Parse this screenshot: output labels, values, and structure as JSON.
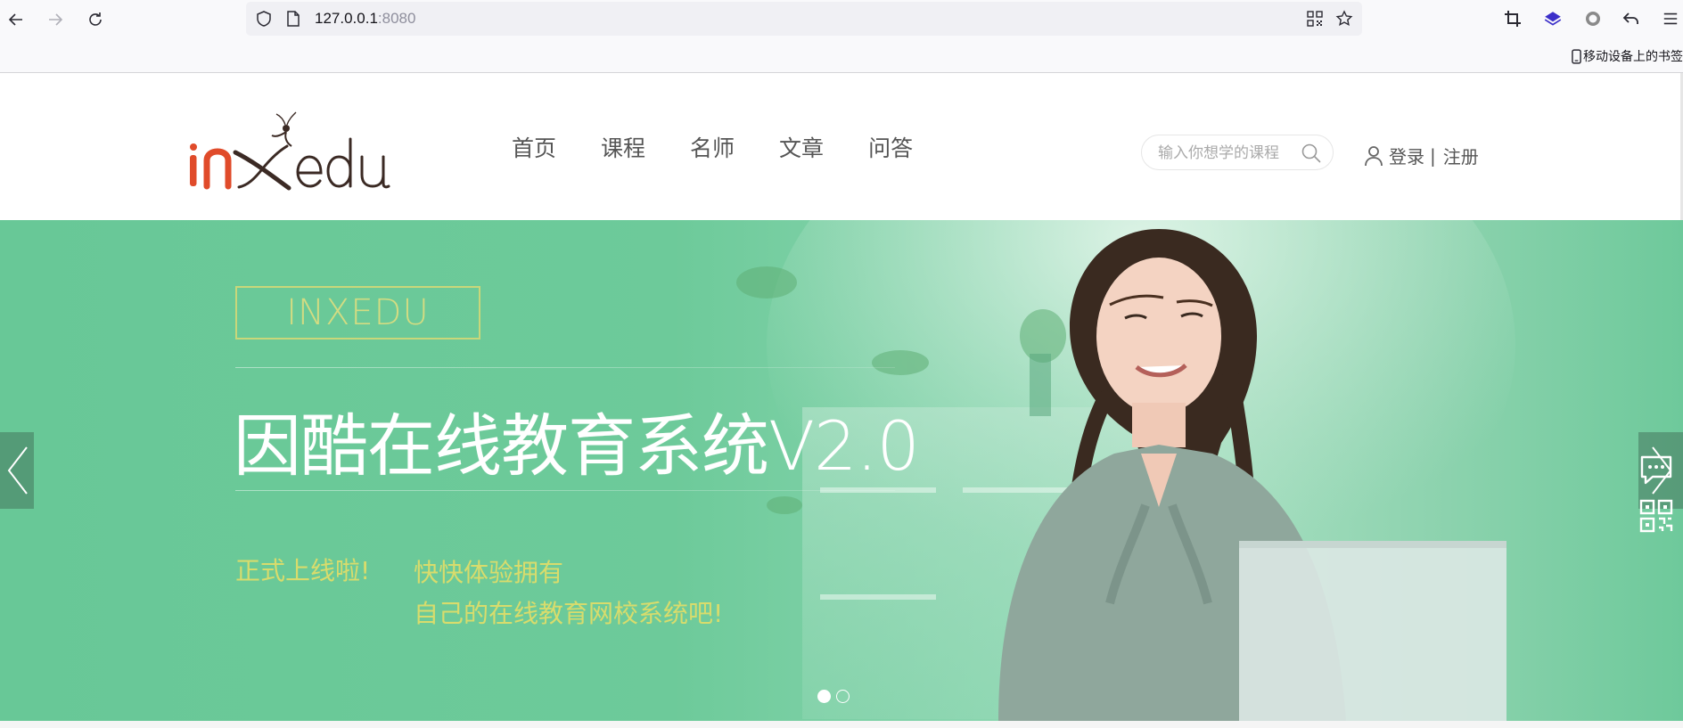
{
  "browser": {
    "url_host": "127.0.0.1",
    "url_port": ":8080",
    "mobile_bookmarks_label": "移动设备上的书签"
  },
  "site": {
    "nav": [
      "首页",
      "课程",
      "名师",
      "文章",
      "问答"
    ],
    "search_placeholder": "输入你想学的课程",
    "login_label": "登录",
    "separator": "|",
    "register_label": "注册"
  },
  "banner": {
    "brand_box": "INXEDU",
    "headline": "因酷在线教育系统V2.0",
    "tag_online": "正式上线啦!",
    "tag_try_line1": "快快体验拥有",
    "tag_try_line2": "自己的在线教育网校系统吧!",
    "slides_total": 2,
    "active_slide": 1
  },
  "colors": {
    "banner_green": "#68c897",
    "accent_yellow": "#d8dc6c",
    "logo_orange": "#e04b2a",
    "logo_brown": "#3b2a24"
  }
}
